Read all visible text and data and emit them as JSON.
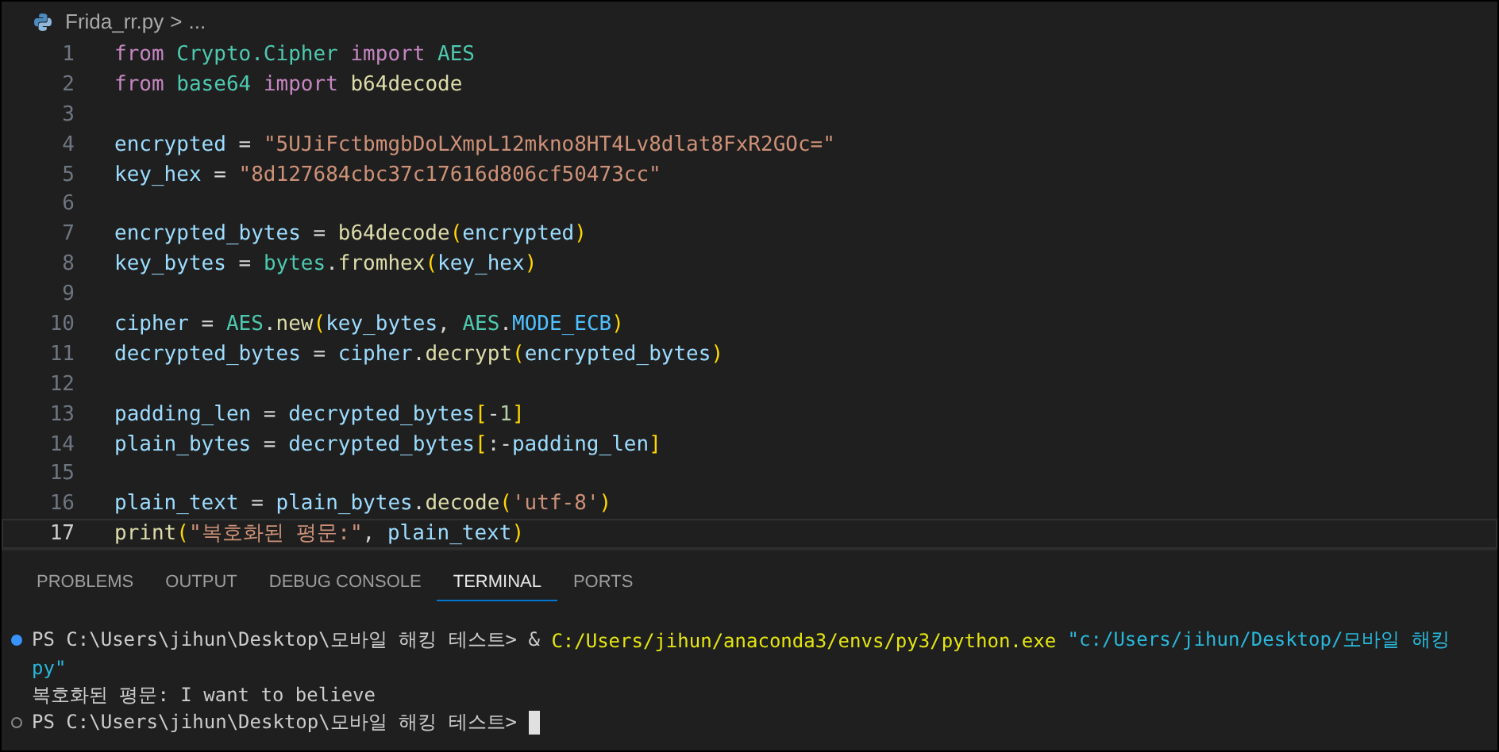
{
  "breadcrumb": {
    "file": "Frida_rr.py",
    "separator": ">",
    "more": "..."
  },
  "editor": {
    "lines": [
      {
        "number": "1",
        "current": false,
        "tokens": [
          {
            "kind": "kw",
            "text": "from "
          },
          {
            "kind": "mod",
            "text": "Crypto.Cipher "
          },
          {
            "kind": "kw",
            "text": "import "
          },
          {
            "kind": "mod",
            "text": "AES"
          }
        ]
      },
      {
        "number": "2",
        "current": false,
        "tokens": [
          {
            "kind": "kw",
            "text": "from "
          },
          {
            "kind": "mod",
            "text": "base64 "
          },
          {
            "kind": "kw",
            "text": "import "
          },
          {
            "kind": "fn",
            "text": "b64decode"
          }
        ]
      },
      {
        "number": "3",
        "current": false
      },
      {
        "number": "4",
        "current": false,
        "tokens": [
          {
            "kind": "var",
            "text": "encrypted"
          },
          {
            "kind": "op",
            "text": " = "
          },
          {
            "kind": "str",
            "text": "\"5UJiFctbmgbDoLXmpL12mkno8HT4Lv8dlat8FxR2GOc=\""
          }
        ]
      },
      {
        "number": "5",
        "current": false,
        "tokens": [
          {
            "kind": "var",
            "text": "key_hex"
          },
          {
            "kind": "op",
            "text": " = "
          },
          {
            "kind": "str",
            "text": "\"8d127684cbc37c17616d806cf50473cc\""
          }
        ]
      },
      {
        "number": "6",
        "current": false
      },
      {
        "number": "7",
        "current": false,
        "tokens": [
          {
            "kind": "var",
            "text": "encrypted_bytes"
          },
          {
            "kind": "op",
            "text": " = "
          },
          {
            "kind": "fn",
            "text": "b64decode"
          },
          {
            "kind": "paren",
            "text": "("
          },
          {
            "kind": "var",
            "text": "encrypted"
          },
          {
            "kind": "paren",
            "text": ")"
          }
        ]
      },
      {
        "number": "8",
        "current": false,
        "tokens": [
          {
            "kind": "var",
            "text": "key_bytes"
          },
          {
            "kind": "op",
            "text": " = "
          },
          {
            "kind": "mod",
            "text": "bytes"
          },
          {
            "kind": "op",
            "text": "."
          },
          {
            "kind": "fn",
            "text": "fromhex"
          },
          {
            "kind": "paren",
            "text": "("
          },
          {
            "kind": "var",
            "text": "key_hex"
          },
          {
            "kind": "paren",
            "text": ")"
          }
        ]
      },
      {
        "number": "9",
        "current": false
      },
      {
        "number": "10",
        "current": false,
        "tokens": [
          {
            "kind": "var",
            "text": "cipher"
          },
          {
            "kind": "op",
            "text": " = "
          },
          {
            "kind": "mod",
            "text": "AES"
          },
          {
            "kind": "op",
            "text": "."
          },
          {
            "kind": "fn",
            "text": "new"
          },
          {
            "kind": "paren",
            "text": "("
          },
          {
            "kind": "var",
            "text": "key_bytes"
          },
          {
            "kind": "op",
            "text": ", "
          },
          {
            "kind": "mod",
            "text": "AES"
          },
          {
            "kind": "op",
            "text": "."
          },
          {
            "kind": "const",
            "text": "MODE_ECB"
          },
          {
            "kind": "paren",
            "text": ")"
          }
        ]
      },
      {
        "number": "11",
        "current": false,
        "tokens": [
          {
            "kind": "var",
            "text": "decrypted_bytes"
          },
          {
            "kind": "op",
            "text": " = "
          },
          {
            "kind": "var",
            "text": "cipher"
          },
          {
            "kind": "op",
            "text": "."
          },
          {
            "kind": "fn",
            "text": "decrypt"
          },
          {
            "kind": "paren",
            "text": "("
          },
          {
            "kind": "var",
            "text": "encrypted_bytes"
          },
          {
            "kind": "paren",
            "text": ")"
          }
        ]
      },
      {
        "number": "12",
        "current": false
      },
      {
        "number": "13",
        "current": false,
        "tokens": [
          {
            "kind": "var",
            "text": "padding_len"
          },
          {
            "kind": "op",
            "text": " = "
          },
          {
            "kind": "var",
            "text": "decrypted_bytes"
          },
          {
            "kind": "paren",
            "text": "["
          },
          {
            "kind": "op",
            "text": "-"
          },
          {
            "kind": "num",
            "text": "1"
          },
          {
            "kind": "paren",
            "text": "]"
          }
        ]
      },
      {
        "number": "14",
        "current": false,
        "tokens": [
          {
            "kind": "var",
            "text": "plain_bytes"
          },
          {
            "kind": "op",
            "text": " = "
          },
          {
            "kind": "var",
            "text": "decrypted_bytes"
          },
          {
            "kind": "paren",
            "text": "["
          },
          {
            "kind": "op",
            "text": ":-"
          },
          {
            "kind": "var",
            "text": "padding_len"
          },
          {
            "kind": "paren",
            "text": "]"
          }
        ]
      },
      {
        "number": "15",
        "current": false
      },
      {
        "number": "16",
        "current": false,
        "tokens": [
          {
            "kind": "var",
            "text": "plain_text"
          },
          {
            "kind": "op",
            "text": " = "
          },
          {
            "kind": "var",
            "text": "plain_bytes"
          },
          {
            "kind": "op",
            "text": "."
          },
          {
            "kind": "fn",
            "text": "decode"
          },
          {
            "kind": "paren",
            "text": "("
          },
          {
            "kind": "str",
            "text": "'utf-8'"
          },
          {
            "kind": "paren",
            "text": ")"
          }
        ]
      },
      {
        "number": "17",
        "current": true,
        "tokens": [
          {
            "kind": "fn",
            "text": "print"
          },
          {
            "kind": "paren",
            "text": "("
          },
          {
            "kind": "str",
            "text": "\"복호화된 평문:\""
          },
          {
            "kind": "op",
            "text": ", "
          },
          {
            "kind": "var",
            "text": "plain_text"
          },
          {
            "kind": "paren",
            "text": ")"
          }
        ]
      }
    ]
  },
  "panel": {
    "tabs": [
      {
        "label": "PROBLEMS",
        "selected": false
      },
      {
        "label": "OUTPUT",
        "selected": false
      },
      {
        "label": "DEBUG CONSOLE",
        "selected": false
      },
      {
        "label": "TERMINAL",
        "selected": true
      },
      {
        "label": "PORTS",
        "selected": false
      }
    ],
    "terminal": [
      {
        "kind": "success",
        "segments": [
          {
            "kind": "plain",
            "text": "PS C:\\Users\\jihun\\Desktop\\모바일 해킹 테스트> & "
          },
          {
            "kind": "path",
            "text": "C:/Users/jihun/anaconda3/envs/py3/python.exe "
          },
          {
            "kind": "quoted",
            "text": "\"c:/Users/jihun/Desktop/모바일 해킹"
          }
        ]
      },
      {
        "kind": "output",
        "segments": [
          {
            "kind": "quoted",
            "text": "py\""
          }
        ]
      },
      {
        "kind": "output",
        "segments": [
          {
            "kind": "plain",
            "text": "복호화된 평문: I want to believe"
          }
        ]
      },
      {
        "kind": "pending",
        "segments": [
          {
            "kind": "plain",
            "text": "PS C:\\Users\\jihun\\Desktop\\모바일 해킹 테스트> "
          }
        ],
        "cursor": true
      }
    ]
  }
}
